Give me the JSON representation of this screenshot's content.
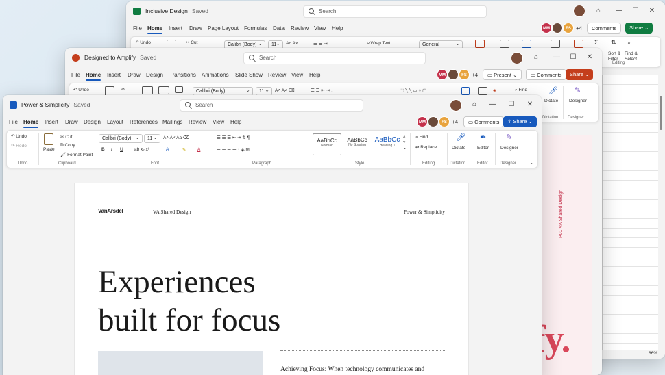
{
  "excel": {
    "title": "Inclusive Design",
    "saved": "Saved",
    "search": "Search",
    "menu": [
      "File",
      "Home",
      "Insert",
      "Draw",
      "Page Layout",
      "Formulas",
      "Data",
      "Review",
      "View",
      "Help"
    ],
    "ribbon": {
      "undo": "Undo",
      "cut": "Cut",
      "font": "Calibri (Body)",
      "size": "11",
      "wrap": "Wrap Text",
      "format": "General",
      "sort": "Sort &",
      "filter": "Filter",
      "find": "Find &",
      "select": "Select",
      "editing": "Editing"
    },
    "avatars": [
      "MM",
      "FS"
    ],
    "more": "+4",
    "comments": "Comments",
    "share": "Share",
    "zoom": "86%"
  },
  "ppt": {
    "title": "Designed to Amplify",
    "saved": "Saved",
    "search": "Search",
    "menu": [
      "File",
      "Home",
      "Insert",
      "Draw",
      "Design",
      "Transitions",
      "Animations",
      "Slide Show",
      "Review",
      "View",
      "Help"
    ],
    "ribbon": {
      "undo": "Undo",
      "font": "Calibri (Body)",
      "size": "11",
      "find": "Find",
      "dictate": "Dictate",
      "designer": "Designer",
      "dictation": "Dictation",
      "designer_group": "Designer"
    },
    "avatars": [
      "MM",
      "FS"
    ],
    "more": "+4",
    "present": "Present",
    "comments": "Comments",
    "share": "Share",
    "slide": {
      "vertical": "P01   VA Shared Design",
      "big": "fy."
    }
  },
  "word": {
    "title": "Power & Simplicity",
    "saved": "Saved",
    "search": "Search",
    "menu": [
      "File",
      "Home",
      "Insert",
      "Draw",
      "Design",
      "Layout",
      "References",
      "Mailings",
      "Review",
      "View",
      "Help"
    ],
    "ribbon": {
      "undo": "Undo",
      "redo": "Redo",
      "paste": "Paste",
      "cut": "Cut",
      "copy": "Copy",
      "format_painter": "Format Paint",
      "font": "Calibri (Body)",
      "size": "11",
      "styles": [
        {
          "sample": "AaBbCc",
          "name": "Normal*"
        },
        {
          "sample": "AaBbCc",
          "name": "No Spacing"
        },
        {
          "sample": "AaBbCc",
          "name": "Heading 1"
        }
      ],
      "find": "Find",
      "replace": "Replace",
      "dictate": "Dictate",
      "editor": "Editor",
      "designer": "Designer",
      "groups": [
        "Undo",
        "Clipboard",
        "Font",
        "Paragraph",
        "Style",
        "Editing",
        "Dictation",
        "Editor",
        "Designer"
      ]
    },
    "avatars": [
      "MM",
      "FS"
    ],
    "more": "+4",
    "comments": "Comments",
    "share": "Share",
    "doc": {
      "brand": "VanArsdel",
      "header_mid": "VA Shared Design",
      "header_right": "Power & Simplicity",
      "heading_l1": "Experiences",
      "heading_l2": "built for focus",
      "body": "Achieving Focus: When technology communicates and"
    }
  },
  "colors": {
    "word": "#185abd",
    "ppt": "#c43e1c",
    "excel": "#107c41"
  }
}
